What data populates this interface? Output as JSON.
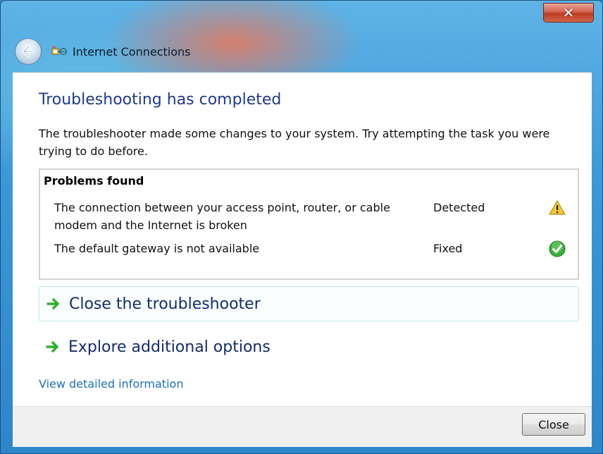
{
  "window": {
    "title": "Internet Connections",
    "close_glyph": "✕"
  },
  "main": {
    "heading": "Troubleshooting has completed",
    "description": "The troubleshooter made some changes to your system. Try attempting the task you were trying to do before."
  },
  "problems": {
    "title": "Problems found",
    "rows": [
      {
        "description": "The connection between your access point, router, or cable modem and the Internet is broken",
        "status": "Detected",
        "icon": "warning-icon"
      },
      {
        "description": "The default gateway is not available",
        "status": "Fixed",
        "icon": "check-icon"
      }
    ]
  },
  "commands": {
    "close_troubleshooter": "Close the troubleshooter",
    "explore_options": "Explore additional options"
  },
  "links": {
    "view_details": "View detailed information"
  },
  "footer": {
    "close_button": "Close"
  },
  "colors": {
    "heading": "#1e3a8c",
    "link": "#1f6fbe",
    "command_text": "#142c6e",
    "arrow": "#2db02d"
  }
}
